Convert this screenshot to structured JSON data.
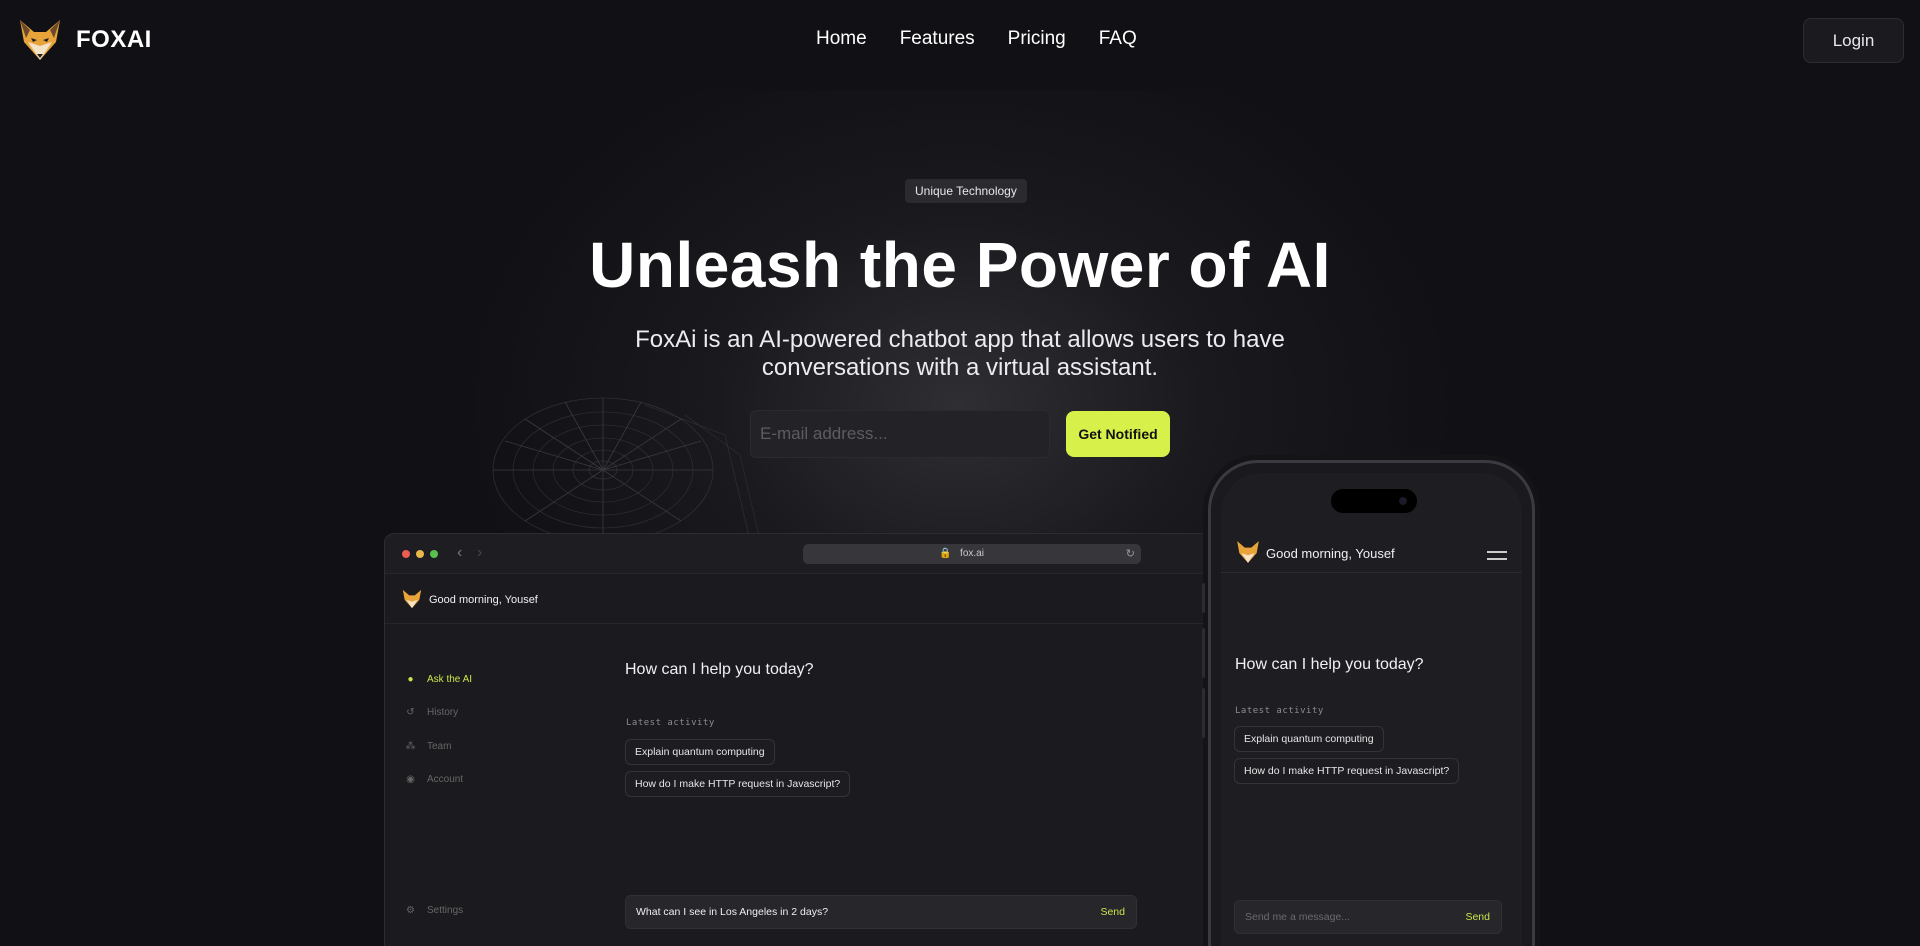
{
  "nav": {
    "brand": "FOXAI",
    "links": [
      "Home",
      "Features",
      "Pricing",
      "FAQ"
    ],
    "login_label": "Login"
  },
  "hero": {
    "badge": "Unique Technology",
    "title": "Unleash the Power of AI",
    "subtitle": "FoxAi is an AI-powered chatbot app that allows users to have conversations with a virtual assistant.",
    "email_placeholder": "E-mail address...",
    "cta_label": "Get Notified"
  },
  "desktop_app": {
    "url": "fox.ai",
    "greeting_prefix": "Good morning,",
    "greeting_name": "Yousef",
    "sidebar": [
      {
        "label": "Ask the AI",
        "icon": "chat-icon",
        "active": true
      },
      {
        "label": "History",
        "icon": "history-icon",
        "active": false
      },
      {
        "label": "Team",
        "icon": "team-icon",
        "active": false
      },
      {
        "label": "Account",
        "icon": "account-icon",
        "active": false
      }
    ],
    "settings_label": "Settings",
    "question": "How can I help you today?",
    "latest_activity_label": "Latest activity",
    "activity": [
      "Explain quantum computing",
      "How do I make HTTP request in Javascript?"
    ],
    "input_value": "What can I see in Los Angeles in 2 days?",
    "send_label": "Send"
  },
  "mobile_app": {
    "greeting_prefix": "Good morning,",
    "greeting_name": "Yousef",
    "question": "How can I help you today?",
    "latest_activity_label": "Latest activity",
    "activity": [
      "Explain quantum computing",
      "How do I make HTTP request in Javascript?"
    ],
    "input_placeholder": "Send me a message...",
    "send_label": "Send"
  },
  "colors": {
    "background": "#111115",
    "accent": "#d8f14a",
    "accent_text": "#c8e64a"
  }
}
